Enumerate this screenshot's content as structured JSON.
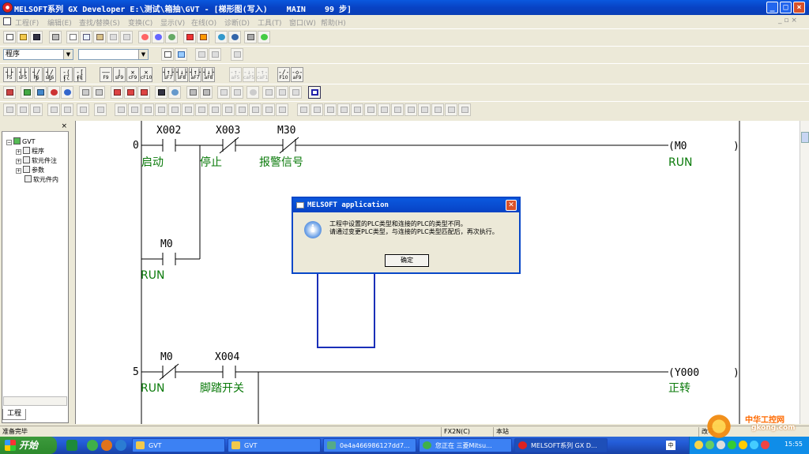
{
  "window": {
    "title": "MELSOFT系列 GX Developer E:\\测试\\箱抽\\GVT - [梯形图(写入)    MAIN    99 步]",
    "buttons": [
      "_",
      "□",
      "×"
    ]
  },
  "menubar": {
    "items": [
      "工程(F)",
      "编辑(E)",
      "查找/替换(S)",
      "变换(C)",
      "显示(V)",
      "在线(O)",
      "诊断(D)",
      "工具(T)",
      "窗口(W)",
      "帮助(H)"
    ],
    "mdi_controls": "_ ▫ ×"
  },
  "toolbar_combo": {
    "data_type": "程序",
    "second": ""
  },
  "ladder_keys": [
    {
      "icon": "┤├",
      "key": "F5"
    },
    {
      "icon": "┤├",
      "key": "sF5"
    },
    {
      "icon": "┤/├",
      "key": "F6"
    },
    {
      "icon": "┤/├",
      "key": "sF6"
    },
    {
      "icon": "-( )-",
      "key": "F7"
    },
    {
      "icon": "-[ ]-",
      "key": "F8"
    },
    {
      "icon": "——",
      "key": "F9"
    },
    {
      "icon": "|",
      "key": "sF9"
    },
    {
      "icon": "✕",
      "key": "cF9"
    },
    {
      "icon": "✕",
      "key": "cF10"
    },
    {
      "icon": "┤↑├",
      "key": "sF7"
    },
    {
      "icon": "┤↓├",
      "key": "sF8"
    },
    {
      "icon": "┤↑├",
      "key": "aF7"
    },
    {
      "icon": "┤↓├",
      "key": "aF8"
    },
    {
      "icon": "-↑-",
      "key": "aF5"
    },
    {
      "icon": "-↓-",
      "key": "caF5"
    },
    {
      "icon": "-↑-",
      "key": "caF10"
    },
    {
      "icon": "-/-",
      "key": "F10"
    },
    {
      "icon": "-◇-",
      "key": "aF9"
    }
  ],
  "project_tree": {
    "root": "GVT",
    "nodes": [
      "程序",
      "软元件注",
      "参数",
      "软元件内"
    ],
    "tab": "工程"
  },
  "ladder": {
    "rungs": [
      {
        "step": "0",
        "contacts": [
          {
            "device": "X002",
            "comment": "启动",
            "type": "NO"
          },
          {
            "device": "X003",
            "comment": "停止",
            "type": "NC"
          },
          {
            "device": "M30",
            "comment": "报警信号",
            "type": "NC"
          }
        ],
        "branch": {
          "device": "M0",
          "comment": "RUN",
          "type": "NO"
        },
        "coil": {
          "device": "(M0",
          "comment": "RUN"
        }
      },
      {
        "step": "5",
        "contacts": [
          {
            "device": "M0",
            "comment": "RUN",
            "type": "NC"
          },
          {
            "device": "X004",
            "comment": "脚踏开关",
            "type": "NO"
          }
        ],
        "coil": {
          "device": "(Y000",
          "comment": "正转"
        }
      }
    ]
  },
  "dialog": {
    "title": "MELSOFT application",
    "line1": "工程中设置的PLC类型和连接的PLC的类型不同。",
    "line2": "请通过变更PLC类型，与连接的PLC类型匹配后，再次执行。",
    "ok": "确定"
  },
  "statusbar": {
    "ready": "准备完毕",
    "plc": "FX2N(C)",
    "station": "本站",
    "mode": "改写"
  },
  "taskbar": {
    "start": "开始",
    "tasks": [
      "GVT",
      "GVT",
      "0e4a466986127dd7...",
      "您正在 三菱Mitsu...",
      "MELSOFT系列 GX D..."
    ],
    "clock": "15:55"
  },
  "watermark": {
    "line1": "中华工控网",
    "line2": "gkong.com"
  }
}
